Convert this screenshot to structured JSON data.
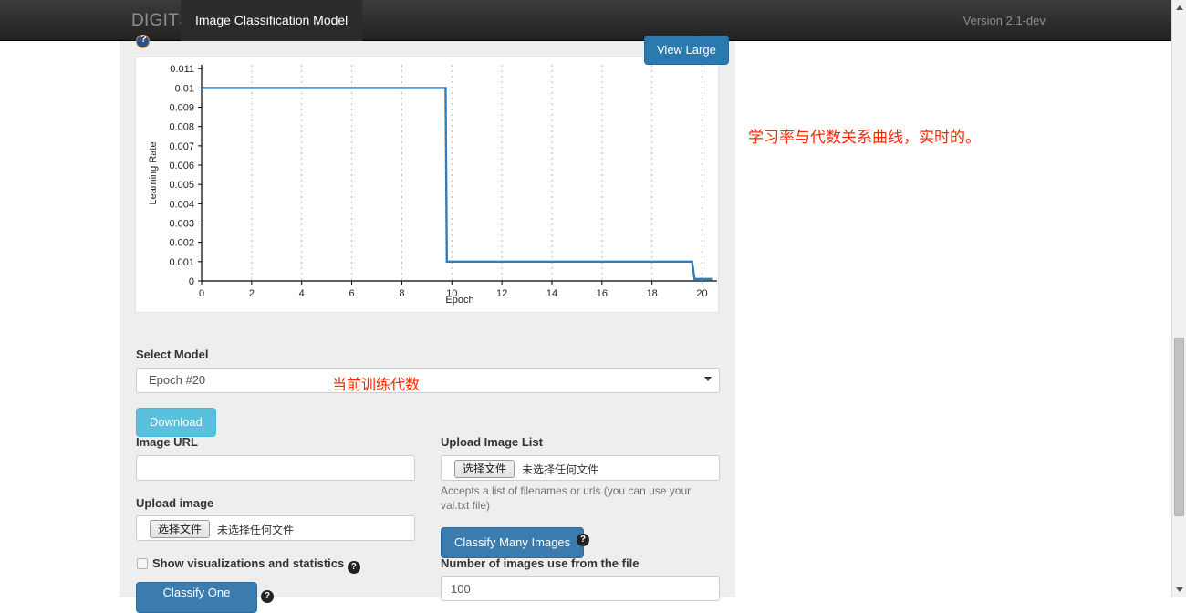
{
  "navbar": {
    "brand": "DIGITS",
    "tab": "Image Classification Model",
    "version": "Version 2.1-dev"
  },
  "chart_panel": {
    "view_large_label": "View Large",
    "help_icon": "question-circle-icon"
  },
  "annotations": {
    "chart": "学习率与代数关系曲线，实时的。",
    "select_model": "当前训练代数",
    "color": "#fa2800"
  },
  "form": {
    "select_model_label": "Select Model",
    "select_model_value": "Epoch #20",
    "download_label": "Download",
    "image_url_label": "Image URL",
    "image_url_value": "",
    "image_url_placeholder": "",
    "upload_image_label": "Upload image",
    "file_button_label": "选择文件",
    "file_none_label": "未选择任何文件",
    "show_viz_label": "Show visualizations and statistics",
    "classify_one_label": "Classify One",
    "help_glyph": "?"
  },
  "right_column": {
    "upload_list_label": "Upload Image List",
    "upload_list_help": "Accepts a list of filenames or urls (you can use your val.txt file)",
    "classify_many_label": "Classify Many Images",
    "num_images_label": "Number of images use from the file",
    "num_images_value": "100"
  },
  "colors": {
    "primary_button": "#3b7cb0",
    "info_button": "#5bc0de",
    "chart_line": "#2e7ebb",
    "navbar": "#222222"
  },
  "chart_data": {
    "type": "line",
    "title": "",
    "xlabel": "Epoch",
    "ylabel": "Learning Rate",
    "xlim": [
      0,
      20.6
    ],
    "ylim": [
      0,
      0.0112
    ],
    "xticks": [
      0,
      2,
      4,
      6,
      8,
      10,
      12,
      14,
      16,
      18,
      20
    ],
    "yticks": [
      0,
      0.001,
      0.002,
      0.003,
      0.004,
      0.005,
      0.006,
      0.007,
      0.008,
      0.009,
      0.01,
      0.011
    ],
    "ytick_labels": [
      "0",
      "0.001",
      "0.002",
      "0.003",
      "0.004",
      "0.005",
      "0.006",
      "0.007",
      "0.008",
      "0.009",
      "0.01",
      "0.011"
    ],
    "grid": "vertical-dashed",
    "legend": null,
    "series": [
      {
        "name": "Learning Rate",
        "x": [
          0,
          9.75,
          9.8,
          19.6,
          19.7,
          20.4
        ],
        "y": [
          0.01,
          0.01,
          0.001,
          0.001,
          0.0001,
          0.0001
        ]
      }
    ]
  }
}
